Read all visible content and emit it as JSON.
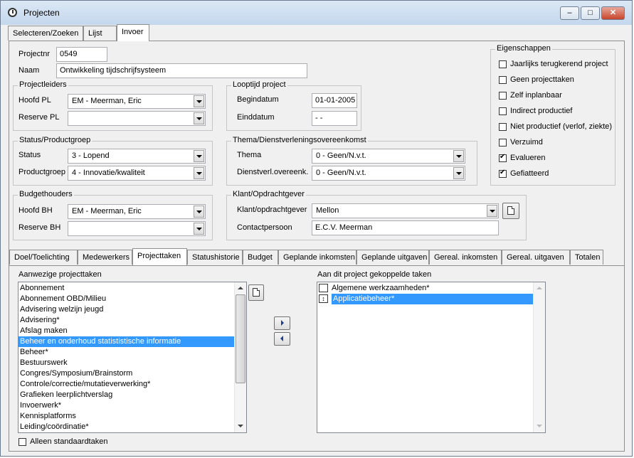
{
  "window": {
    "title": "Projecten",
    "controls": {
      "minimize": "–",
      "maximize": "□",
      "close": "✕"
    }
  },
  "top_tabs": [
    {
      "label": "Selecteren/Zoeken"
    },
    {
      "label": "Lijst"
    },
    {
      "label": "Invoer"
    }
  ],
  "project": {
    "nr_label": "Projectnr",
    "nr_value": "0549",
    "naam_label": "Naam",
    "naam_value": "Ontwikkeling tijdschrijfsysteem"
  },
  "projectleiders": {
    "title": "Projectleiders",
    "hoofd_label": "Hoofd PL",
    "hoofd_value": "EM - Meerman, Eric",
    "reserve_label": "Reserve PL",
    "reserve_value": ""
  },
  "looptijd": {
    "title": "Looptijd project",
    "begin_label": "Begindatum",
    "begin_value": "01-01-2005",
    "eind_label": "Einddatum",
    "eind_value": " -  -"
  },
  "status": {
    "title": "Status/Productgroep",
    "status_label": "Status",
    "status_value": "3 - Lopend",
    "product_label": "Productgroep",
    "product_value": "4 - Innovatie/kwaliteit"
  },
  "thema": {
    "title": "Thema/Dienstverleningsovereenkomst",
    "thema_label": "Thema",
    "thema_value": "0 - Geen/N.v.t.",
    "dvo_label": "Dienstverl.overeenk.",
    "dvo_value": "0 - Geen/N.v.t."
  },
  "budget": {
    "title": "Budgethouders",
    "hoofd_label": "Hoofd BH",
    "hoofd_value": "EM - Meerman, Eric",
    "reserve_label": "Reserve BH",
    "reserve_value": ""
  },
  "klant": {
    "title": "Klant/Opdrachtgever",
    "klant_label": "Klant/opdrachtgever",
    "klant_value": "Mellon",
    "contact_label": "Contactpersoon",
    "contact_value": "E.C.V. Meerman"
  },
  "eigenschappen": {
    "title": "Eigenschappen",
    "items": [
      {
        "label": "Jaarlijks terugkerend project",
        "checked": false
      },
      {
        "label": "Geen projecttaken",
        "checked": false
      },
      {
        "label": "Zelf inplanbaar",
        "checked": false
      },
      {
        "label": "Indirect productief",
        "checked": false
      },
      {
        "label": "Niet productief (verlof, ziekte)",
        "checked": false
      },
      {
        "label": "Verzuimd",
        "checked": false
      },
      {
        "label": "Evalueren",
        "checked": true
      },
      {
        "label": "Gefiatteerd",
        "checked": true
      }
    ]
  },
  "bottom_tabs": [
    {
      "label": "Doel/Toelichting"
    },
    {
      "label": "Medewerkers"
    },
    {
      "label": "Projecttaken"
    },
    {
      "label": "Statushistorie"
    },
    {
      "label": "Budget"
    },
    {
      "label": "Geplande inkomsten"
    },
    {
      "label": "Geplande uitgaven"
    },
    {
      "label": "Gereal. inkomsten"
    },
    {
      "label": "Gereal. uitgaven"
    },
    {
      "label": "Totalen"
    }
  ],
  "taken": {
    "left_title": "Aanwezige projecttaken",
    "right_title": "Aan dit project gekoppelde taken",
    "left_items": [
      "Abonnement",
      "Abonnement OBD/Milieu",
      "Advisering welzijn jeugd",
      "Advisering*",
      "Afslag maken",
      "Beheer en onderhoud statististische informatie",
      "Beheer*",
      "Bestuurswerk",
      "Congres/Symposium/Brainstorm",
      "Controle/correctie/mutatieverwerking*",
      "Grafieken leerplichtverslag",
      "Invoerwerk*",
      "Kennisplatforms",
      "Leiding/coördinatie*"
    ],
    "left_selected_index": 5,
    "right_items": [
      "Algemene werkzaamheden*",
      "Applicatiebeheer*"
    ],
    "right_selected_index": 1,
    "only_standard_label": "Alleen standaardtaken"
  }
}
